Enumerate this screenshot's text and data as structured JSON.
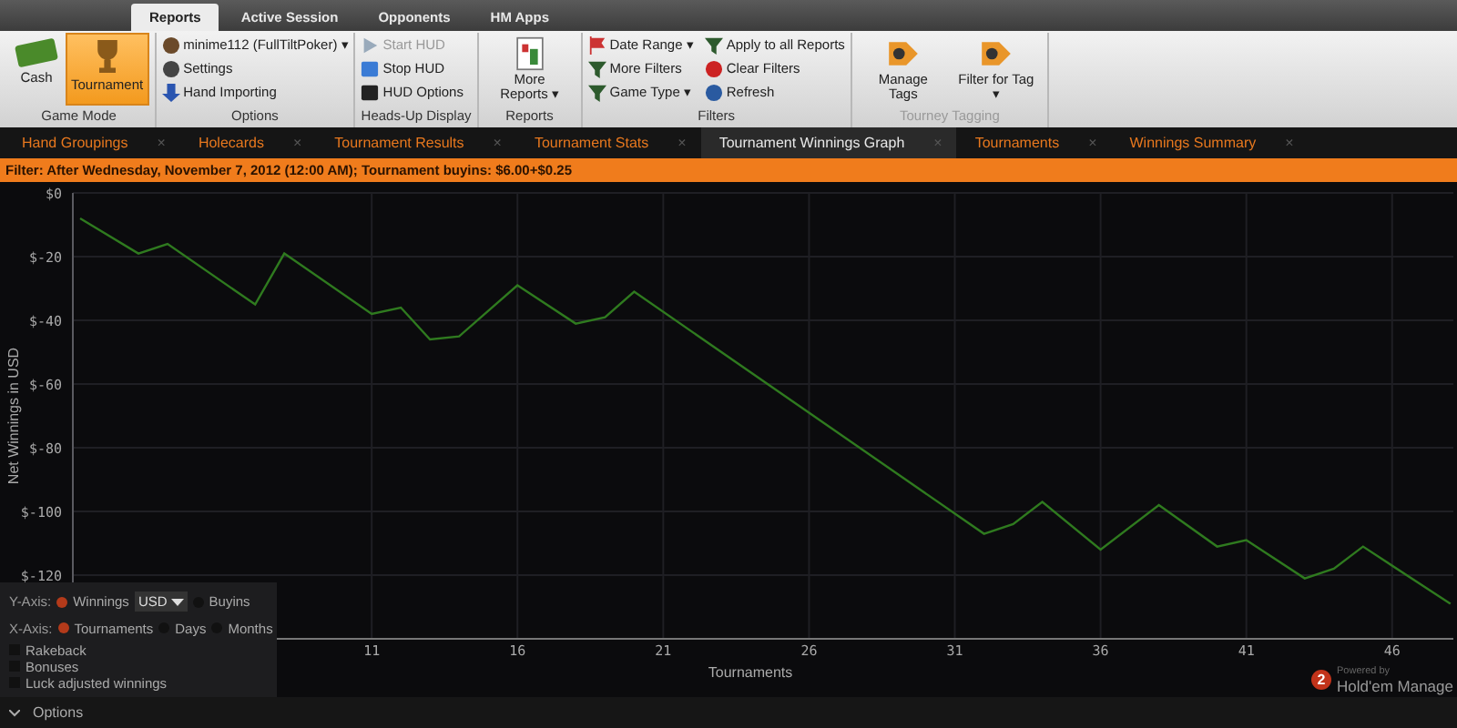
{
  "ribbon_tabs": [
    {
      "label": "Reports",
      "selected": true
    },
    {
      "label": "Active Session",
      "selected": false
    },
    {
      "label": "Opponents",
      "selected": false
    },
    {
      "label": "HM Apps",
      "selected": false
    }
  ],
  "groups": [
    {
      "label": "Game Mode",
      "disabled": false,
      "kind": "large",
      "items": [
        {
          "label": "Cash",
          "selected": false,
          "disabled": false
        },
        {
          "label": "Tournament",
          "selected": true,
          "disabled": false
        }
      ]
    },
    {
      "label": "Options",
      "disabled": false,
      "kind": "small",
      "items": [
        {
          "label": "minime112 (FullTiltPoker) ▾",
          "disabled": false
        },
        {
          "label": "Settings",
          "disabled": false
        },
        {
          "label": "Hand Importing",
          "disabled": false
        }
      ]
    },
    {
      "label": "Heads-Up Display",
      "disabled": false,
      "kind": "small",
      "items": [
        {
          "label": "Start HUD",
          "disabled": true
        },
        {
          "label": "Stop HUD",
          "disabled": false
        },
        {
          "label": "HUD Options",
          "disabled": false
        }
      ]
    },
    {
      "label": "Reports",
      "disabled": false,
      "kind": "large",
      "items": [
        {
          "label": "More Reports ▾",
          "disabled": false
        }
      ]
    },
    {
      "label": "Filters",
      "disabled": false,
      "kind": "small",
      "items": [
        {
          "label": "Date Range ▾",
          "disabled": false
        },
        {
          "label": "More Filters",
          "disabled": false
        },
        {
          "label": "Game Type ▾",
          "disabled": false
        },
        {
          "label": "Apply to all Reports",
          "disabled": false
        },
        {
          "label": "Clear Filters",
          "disabled": false
        },
        {
          "label": "Refresh",
          "disabled": false
        }
      ]
    },
    {
      "label": "Tourney Tagging",
      "disabled": true,
      "kind": "large",
      "items": [
        {
          "label": "Manage Tags",
          "disabled": false
        },
        {
          "label": "Filter for Tag ▾",
          "disabled": false
        }
      ]
    }
  ],
  "doc_tabs": [
    {
      "label": "Hand Groupings",
      "close": "×",
      "selected": false
    },
    {
      "label": "Holecards",
      "close": "×",
      "selected": false
    },
    {
      "label": "Tournament Results",
      "close": "×",
      "selected": false
    },
    {
      "label": "Tournament Stats",
      "close": "×",
      "selected": false
    },
    {
      "label": "Tournament Winnings Graph",
      "close": "×",
      "selected": true
    },
    {
      "label": "Tournaments",
      "close": "×",
      "selected": false
    },
    {
      "label": "Winnings Summary",
      "close": "×",
      "selected": false
    }
  ],
  "filter_bar": "Filter: After Wednesday, November 7, 2012 (12:00 AM); Tournament buyins: $6.00+$0.25",
  "chart": {
    "chart_data": {
      "type": "line",
      "xlabel": "Tournaments",
      "ylabel": "Net Winnings in USD",
      "grid": true,
      "x": [
        1,
        3,
        4,
        7,
        8,
        11,
        12,
        13,
        14,
        16,
        18,
        19,
        20,
        32,
        33,
        34,
        36,
        38,
        40,
        41,
        43,
        44,
        45,
        48
      ],
      "series": [
        {
          "color": "#2f7a1f",
          "values": [
            -8,
            -19,
            -16,
            -35,
            -19,
            -38,
            -36,
            -46,
            -45,
            -29,
            -41,
            -39,
            -31,
            -107,
            -104,
            -97,
            -112,
            -98,
            -111,
            -109,
            -121,
            -118,
            -111,
            -129
          ]
        }
      ],
      "xlim": [
        0.75,
        48.1
      ],
      "ylim": [
        -140,
        0
      ],
      "xticks": [
        11,
        16,
        21,
        26,
        31,
        36,
        41,
        46
      ],
      "yticks": [
        {
          "value": 0,
          "label": "$0"
        },
        {
          "value": -20,
          "label": "$-20"
        },
        {
          "value": -40,
          "label": "$-40"
        },
        {
          "value": -60,
          "label": "$-60"
        },
        {
          "value": -80,
          "label": "$-80"
        },
        {
          "value": -100,
          "label": "$-100"
        },
        {
          "value": -120,
          "label": "$-120"
        }
      ]
    }
  },
  "options_panel": {
    "y_axis": {
      "label": "Y-Axis:",
      "options": [
        {
          "label": "Winnings",
          "selected": true
        },
        {
          "label": "Buyins",
          "selected": false
        }
      ],
      "currency": "USD"
    },
    "x_axis": {
      "label": "X-Axis:",
      "options": [
        {
          "label": "Tournaments",
          "selected": true
        },
        {
          "label": "Days",
          "selected": false
        },
        {
          "label": "Months",
          "selected": false
        }
      ]
    },
    "checkboxes": [
      {
        "label": "Rakeback",
        "checked": false
      },
      {
        "label": "Bonuses",
        "checked": false
      },
      {
        "label": "Luck adjusted winnings",
        "checked": false
      }
    ]
  },
  "options_toggle": "Options",
  "branding": {
    "badge": "2",
    "powered_by": "Powered by",
    "name": "Hold'em Manage"
  }
}
